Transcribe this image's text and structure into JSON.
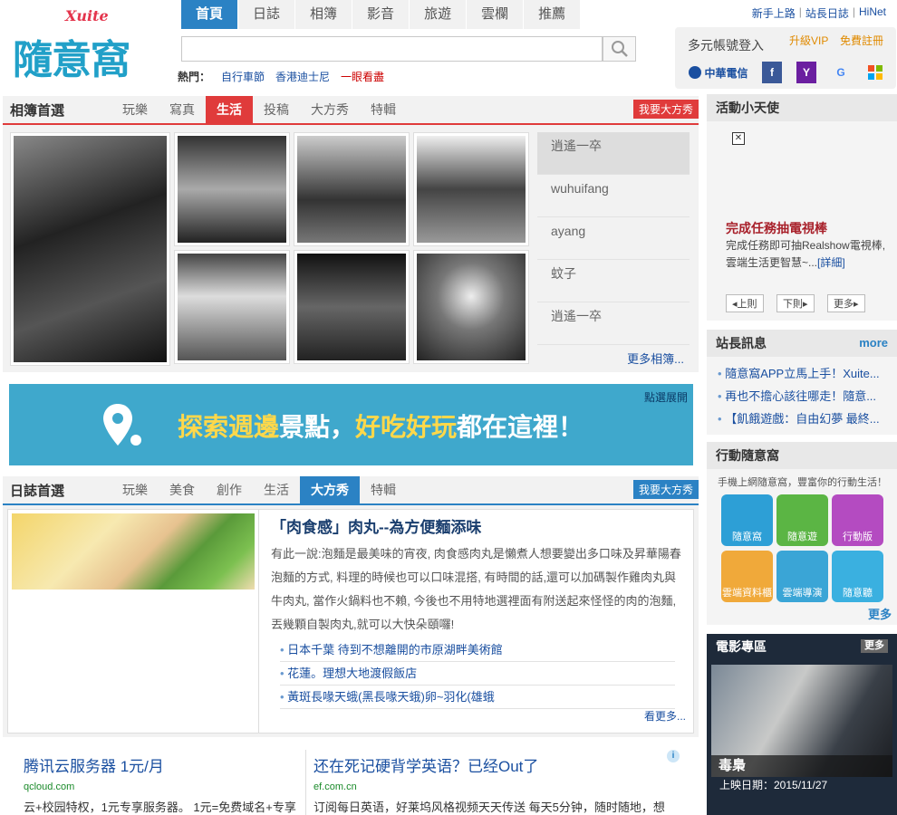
{
  "header": {
    "logo_script": "Xuite",
    "logo_text": "隨意窩",
    "nav": [
      "首頁",
      "日誌",
      "相簿",
      "影音",
      "旅遊",
      "雲欄",
      "推薦"
    ],
    "hot_label": "熱門：",
    "hot_items": [
      "自行車節",
      "香港迪士尼",
      "一眼看盡"
    ],
    "top_links": [
      "新手上路",
      "站長日誌",
      "HiNet"
    ],
    "login_text": "多元帳號登入",
    "vip": "升級VIP",
    "register": "免費註冊",
    "chunghwa": "中華電信",
    "social": [
      "f",
      "Y",
      "G",
      "MS"
    ]
  },
  "album": {
    "title": "相簿首選",
    "tabs": [
      "玩樂",
      "寫真",
      "生活",
      "投稿",
      "大方秀",
      "特輯"
    ],
    "cta": "我要大方秀",
    "names": [
      "逍遙一卒",
      "wuhuifang",
      "ayang",
      "蚊子",
      "逍遙一卒"
    ],
    "more": "更多相簿..."
  },
  "banner": {
    "corner": "點選展開",
    "text_a": "探索週邊",
    "text_b": "景點，",
    "text_c": "好吃好玩",
    "text_d": "都在這裡！"
  },
  "diary": {
    "title": "日誌首選",
    "tabs": [
      "玩樂",
      "美食",
      "創作",
      "生活",
      "大方秀",
      "特輯"
    ],
    "cta": "我要大方秀",
    "headline": "「肉食感」肉丸--為方便麵添味",
    "body": "有此一說:泡麵是最美味的宵夜, 肉食感肉丸是懶煮人想要變出多口味及昇華陽春泡麵的方式, 料理的時候也可以口味混搭, 有時間的話,還可以加碼製作雞肉丸與牛肉丸, 當作火鍋料也不賴, 今後也不用特地選裡面有附送起來怪怪的肉的泡麵, 丟幾顆自製肉丸,就可以大快朵頤囉!",
    "links": [
      "日本千葉 待到不想離開的市原湖畔美術館",
      "花蓮。理想大地渡假飯店",
      "黃斑長喙天蛾(黑長喙天蛾)卵~羽化(雄蛾"
    ],
    "more": "看更多..."
  },
  "sidebar": {
    "angel_title": "活動小天使",
    "angel_headline": "完成任務抽電視棒",
    "angel_text": "完成任務即可抽Realshow電視棒,雲端生活更智慧~...",
    "angel_detail": "[詳細]",
    "prev": "◂上則",
    "next": "下則▸",
    "more_btn": "更多▸",
    "news_title": "站長訊息",
    "news_more": "more",
    "news": [
      "隨意窩APP立馬上手！Xuite...",
      "再也不擔心該往哪走！隨意...",
      "【飢餓遊戲：自由幻夢 最終..."
    ],
    "mobile_title": "行動隨意窩",
    "mobile_sub": "手機上網隨意窩，豐富你的行動生活！",
    "apps": [
      "隨意窩",
      "隨意遊",
      "行動版",
      "雲端資料櫃",
      "雲端導演",
      "隨意聽"
    ],
    "apps_more": "更多",
    "movie_title": "電影專區",
    "movie_more": "更多",
    "movie_name": "毒梟",
    "movie_date": "上映日期：2015/11/27"
  },
  "ads": [
    {
      "title": "腾讯云服务器 1元/月",
      "domain": "qcloud.com",
      "desc": "云+校园特权，1元专享服务器。 1元=免费域名+专享"
    },
    {
      "title": "还在死记硬背学英语？已经Out了",
      "domain": "ef.com.cn",
      "desc": "订阅每日英语，好莱坞风格视频天天传送 每天5分钟，随时随地，想"
    }
  ],
  "colors": {
    "blue": "#2b82c4",
    "red": "#e03b3b",
    "brand": "#21a0c8",
    "banner": "#3fa8cc"
  }
}
